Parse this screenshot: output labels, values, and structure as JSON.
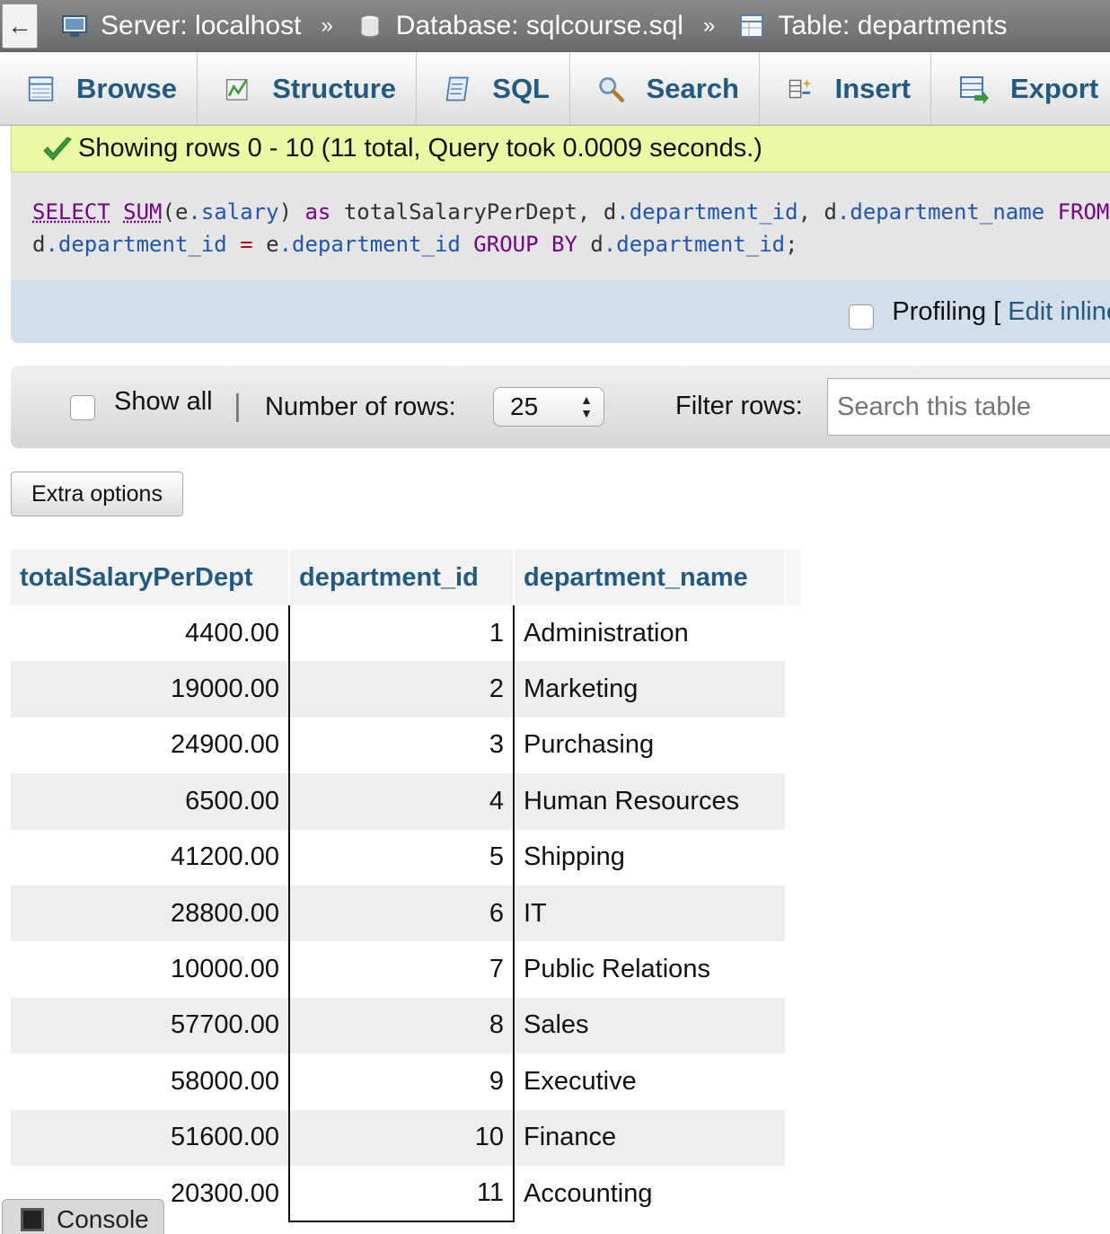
{
  "breadcrumb": {
    "back": "←",
    "server": "Server: localhost",
    "database": "Database: sqlcourse.sql",
    "table": "Table: departments",
    "separator": "»"
  },
  "tabs": [
    {
      "label": "Browse",
      "icon": "browse-icon"
    },
    {
      "label": "Structure",
      "icon": "structure-icon"
    },
    {
      "label": "SQL",
      "icon": "sql-icon"
    },
    {
      "label": "Search",
      "icon": "search-icon"
    },
    {
      "label": "Insert",
      "icon": "insert-icon"
    },
    {
      "label": "Export",
      "icon": "export-icon"
    }
  ],
  "message": "Showing rows 0 - 10 (11 total, Query took 0.0009 seconds.)",
  "sql": {
    "select": "SELECT",
    "sum": "SUM",
    "line1_a": "(e",
    "line1_b": ".salary",
    "line1_c": ") ",
    "as": "as",
    "line1_d": " totalSalaryPerDept, d",
    "line1_e": ".department_id",
    "line1_f": ", d",
    "line1_g": ".department_name",
    "from": " FROM",
    "line2_a": "d",
    "line2_b": ".department_id",
    "line2_eq": " = ",
    "line2_c": "e",
    "line2_d": ".department_id",
    "group": " GROUP BY",
    "line2_e": " d",
    "line2_f": ".department_id",
    "line2_end": ";"
  },
  "profiling": {
    "label": "Profiling [",
    "edit_inline": "Edit inline"
  },
  "navbar": {
    "show_all": "Show all",
    "divider": "|",
    "rows_label": "Number of rows:",
    "rows_value": "25",
    "filter_label": "Filter rows:",
    "search_placeholder": "Search this table"
  },
  "extra_options": "Extra options",
  "table": {
    "columns": [
      "totalSalaryPerDept",
      "department_id",
      "department_name"
    ],
    "rows": [
      [
        "4400.00",
        "1",
        "Administration"
      ],
      [
        "19000.00",
        "2",
        "Marketing"
      ],
      [
        "24900.00",
        "3",
        "Purchasing"
      ],
      [
        "6500.00",
        "4",
        "Human Resources"
      ],
      [
        "41200.00",
        "5",
        "Shipping"
      ],
      [
        "28800.00",
        "6",
        "IT"
      ],
      [
        "10000.00",
        "7",
        "Public Relations"
      ],
      [
        "57700.00",
        "8",
        "Sales"
      ],
      [
        "58000.00",
        "9",
        "Executive"
      ],
      [
        "51600.00",
        "10",
        "Finance"
      ],
      [
        "20300.00",
        "11",
        "Accounting"
      ]
    ]
  },
  "console": "Console",
  "colors": {
    "link": "#235a81",
    "success_bg": "#ebf8a4",
    "sql_keyword": "#770088"
  }
}
